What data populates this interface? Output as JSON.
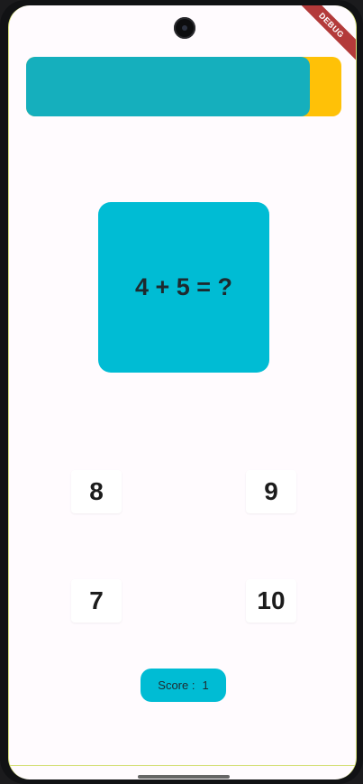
{
  "debug_banner": "DEBUG",
  "timer": {
    "progress_percent": 90,
    "fill_color": "#15afbd",
    "track_color": "#ffc107"
  },
  "question": {
    "text": "4 + 5 = ?"
  },
  "answers": [
    "8",
    "9",
    "7",
    "10"
  ],
  "score": {
    "label": "Score :",
    "value": "1"
  }
}
